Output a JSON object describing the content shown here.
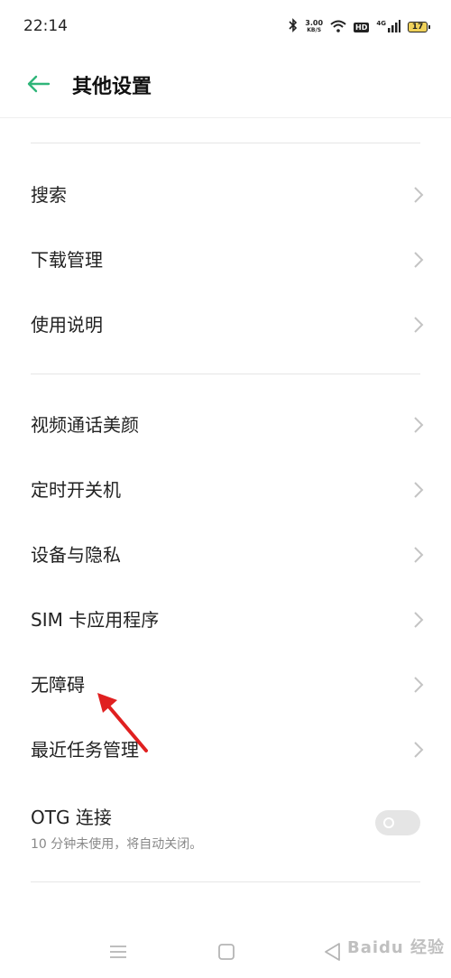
{
  "status_bar": {
    "time": "22:14",
    "speed_value": "3.00",
    "speed_unit": "KB/S",
    "hd_badge": "HD",
    "network_label": "4G",
    "battery_level": "17",
    "icons": [
      "bluetooth-icon",
      "wifi-icon",
      "hd-icon",
      "signal-icon",
      "battery-icon"
    ]
  },
  "header": {
    "title": "其他设置",
    "accent_color": "#2fb579"
  },
  "settings_groups": [
    {
      "items": [
        {
          "label": "搜索"
        },
        {
          "label": "下载管理"
        },
        {
          "label": "使用说明"
        }
      ]
    },
    {
      "items": [
        {
          "label": "视频通话美颜"
        },
        {
          "label": "定时开关机"
        },
        {
          "label": "设备与隐私"
        },
        {
          "label": "SIM 卡应用程序"
        },
        {
          "label": "无障碍"
        },
        {
          "label": "最近任务管理"
        }
      ]
    }
  ],
  "otg": {
    "label": "OTG 连接",
    "sublabel": "10 分钟未使用，将自动关闭。",
    "enabled": false
  },
  "annotation": {
    "arrow_color": "#e02020"
  },
  "watermark": {
    "text": "Baidu 经验"
  },
  "nav_bar": {
    "icons": [
      "menu-icon",
      "home-icon",
      "back-icon"
    ]
  }
}
